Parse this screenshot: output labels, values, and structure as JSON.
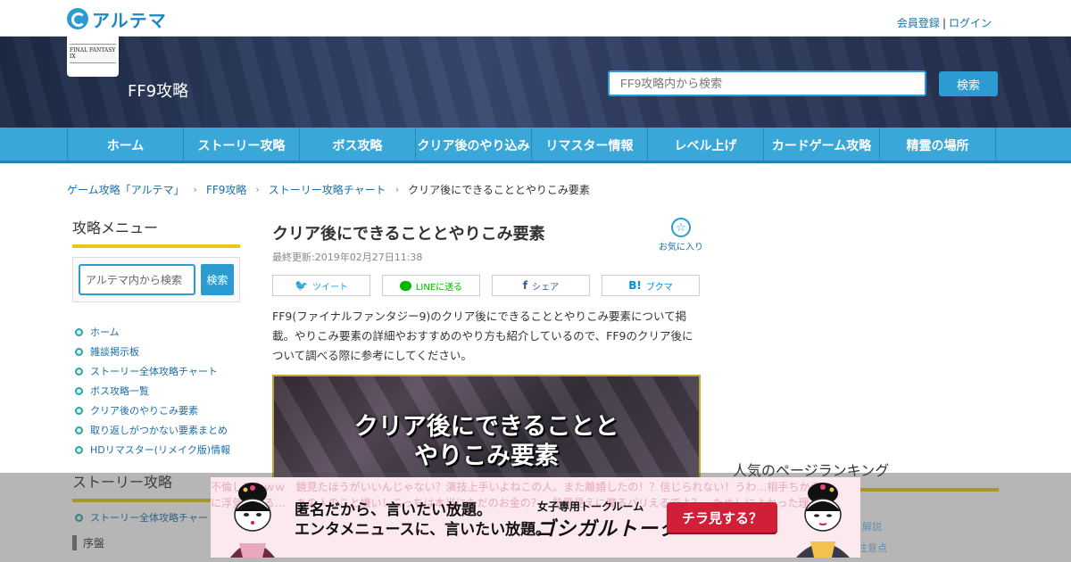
{
  "site": {
    "logo_text": "アルテマ",
    "register": "会員登録",
    "separator": "|",
    "login": "ログイン"
  },
  "header": {
    "game_logo_text": "FINAL FANTASY IX",
    "game_title": "FF9攻略",
    "search_placeholder": "FF9攻略内から検索",
    "search_button": "検索"
  },
  "nav": {
    "items": [
      {
        "label": "ホーム"
      },
      {
        "label": "ストーリー攻略"
      },
      {
        "label": "ボス攻略"
      },
      {
        "label": "クリア後のやり込み"
      },
      {
        "label": "リマスター情報"
      },
      {
        "label": "レベル上げ"
      },
      {
        "label": "カードゲーム攻略"
      },
      {
        "label": "精霊の場所"
      }
    ]
  },
  "breadcrumb": {
    "items": [
      "ゲーム攻略「アルテマ」",
      "FF9攻略",
      "ストーリー攻略チャート"
    ],
    "current": "クリア後にできることとやりこみ要素"
  },
  "sidebar": {
    "title": "攻略メニュー",
    "search_placeholder": "アルテマ内から検索",
    "search_button": "検索",
    "items": [
      {
        "label": "ホーム"
      },
      {
        "label": "雑談掲示板"
      },
      {
        "label": "ストーリー全体攻略チャート"
      },
      {
        "label": "ボス攻略一覧"
      },
      {
        "label": "クリア後のやりこみ要素"
      },
      {
        "label": "取り返しがつかない要素まとめ"
      },
      {
        "label": "HDリマスター(リメイク版)情報"
      }
    ],
    "section2_title": "ストーリー攻略",
    "section2_item": "ストーリー全体攻略チャート",
    "section2_sub": "序盤"
  },
  "article": {
    "title": "クリア後にできることとやりこみ要素",
    "updated": "最終更新:2019年02月27日11:38",
    "favorite": "お気に入り",
    "share": {
      "tweet": "ツイート",
      "line": "LINEに送る",
      "facebook": "シェア",
      "hatena": "ブクマ"
    },
    "intro": "FF9(ファイナルファンタジー9)のクリア後にできることとやりこみ要素について掲載。やりこみ要素の詳細やおすすめのやり方も紹介しているので、FF9のクリア後について調べる際に参考にしてください。",
    "hero_line1": "クリア後にできることと",
    "hero_line2": "やりこみ要素"
  },
  "ranking": {
    "title": "人気のページランキング",
    "peek1": "ス解説",
    "peek2": "注意点"
  },
  "ad": {
    "scroll1": "不倫してたｗｗ　鏡見たほうがいいんじゃない？演技上手いよねこの人。また離婚したの！？信じられない！うわ…相手ちから",
    "scroll2": "に浮気してる…　あの人のこと嫌い！こっちは本当にただのお金の？　熱愛見えに魔るバリえるでよ？　ためしによかった理",
    "line1": "匿名だから、言いたい放題。",
    "line2": "エンタメニュースに、言いたい放題。",
    "sub": "女子専用トークルーム",
    "brand": "ゴシガルトーク",
    "cta": "チラ見する？"
  },
  "colors": {
    "accent": "#2c9bd1",
    "nav": "#39a7d8",
    "underline": "#e6c619",
    "ad_cta": "#d11f37"
  }
}
